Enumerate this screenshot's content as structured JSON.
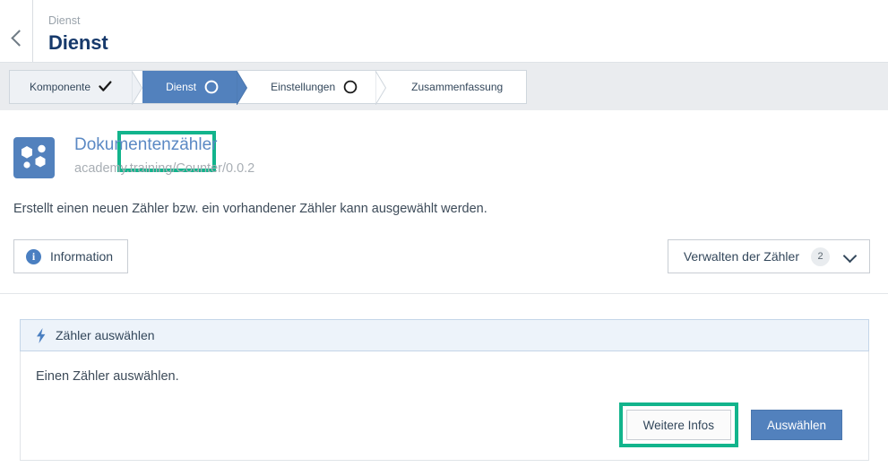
{
  "header": {
    "back_icon": "chevron-left-icon",
    "breadcrumb": "Dienst",
    "title": "Dienst"
  },
  "wizard": {
    "steps": [
      {
        "label": "Komponente",
        "state": "done",
        "icon": "check-icon"
      },
      {
        "label": "Dienst",
        "state": "current",
        "icon": "circle-outline-icon"
      },
      {
        "label": "Einstellungen",
        "state": "upcoming",
        "icon": "circle-outline-icon"
      },
      {
        "label": "Zusammenfassung",
        "state": "upcoming",
        "icon": ""
      }
    ],
    "highlight_color": "#12b48c",
    "current_bg": "#5281bd"
  },
  "service": {
    "icon_name": "molecule-icon",
    "icon_bg": "#5281bd",
    "name": "Dokumentenzähler",
    "identifier": "academy.training/Counter/0.0.2",
    "description": "Erstellt einen neuen Zähler bzw. ein vorhandener Zähler kann ausgewählt werden."
  },
  "actions": {
    "information_label": "Information",
    "information_icon": "info-circle-icon",
    "dropdown_label": "Verwalten der Zähler",
    "dropdown_badge": "2",
    "dropdown_icon": "chevron-down-icon"
  },
  "panel": {
    "head_icon": "lightning-bolt-icon",
    "head_title": "Zähler auswählen",
    "body_text": "Einen Zähler auswählen.",
    "secondary_button": "Weitere Infos",
    "primary_button": "Auswählen",
    "secondary_highlight_color": "#12b48c",
    "primary_color": "#5281bd"
  }
}
